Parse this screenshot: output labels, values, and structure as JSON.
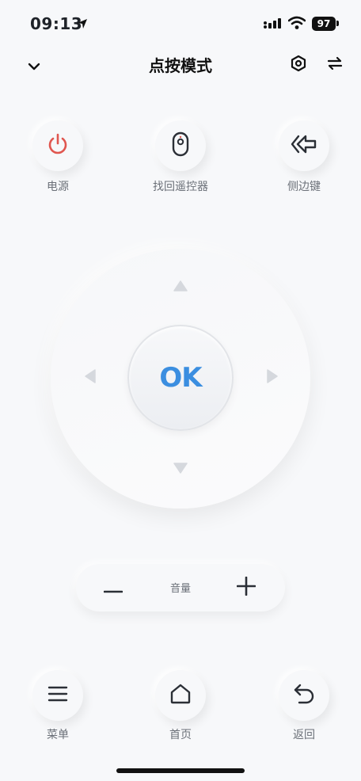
{
  "status": {
    "time": "09:13",
    "battery": "97"
  },
  "header": {
    "title": "点按模式"
  },
  "top_buttons": {
    "power": "电源",
    "find_remote": "找回遥控器",
    "side_key": "侧边键"
  },
  "dpad": {
    "ok_label": "OK"
  },
  "volume": {
    "label": "音量"
  },
  "bottom_buttons": {
    "menu": "菜单",
    "home": "首页",
    "back": "返回"
  },
  "colors": {
    "accent": "#3b8ee0",
    "power": "#e0564f",
    "icon": "#2b2f36",
    "label": "#6b7078"
  },
  "icons": [
    "location-arrow-icon",
    "signal-icon",
    "wifi-icon",
    "chevron-down-icon",
    "settings-hexagon-icon",
    "switch-arrows-icon",
    "power-icon",
    "remote-icon",
    "side-key-icon",
    "arrow-up-icon",
    "arrow-down-icon",
    "arrow-left-icon",
    "arrow-right-icon",
    "minus-icon",
    "plus-icon",
    "menu-icon",
    "home-icon",
    "back-icon"
  ]
}
